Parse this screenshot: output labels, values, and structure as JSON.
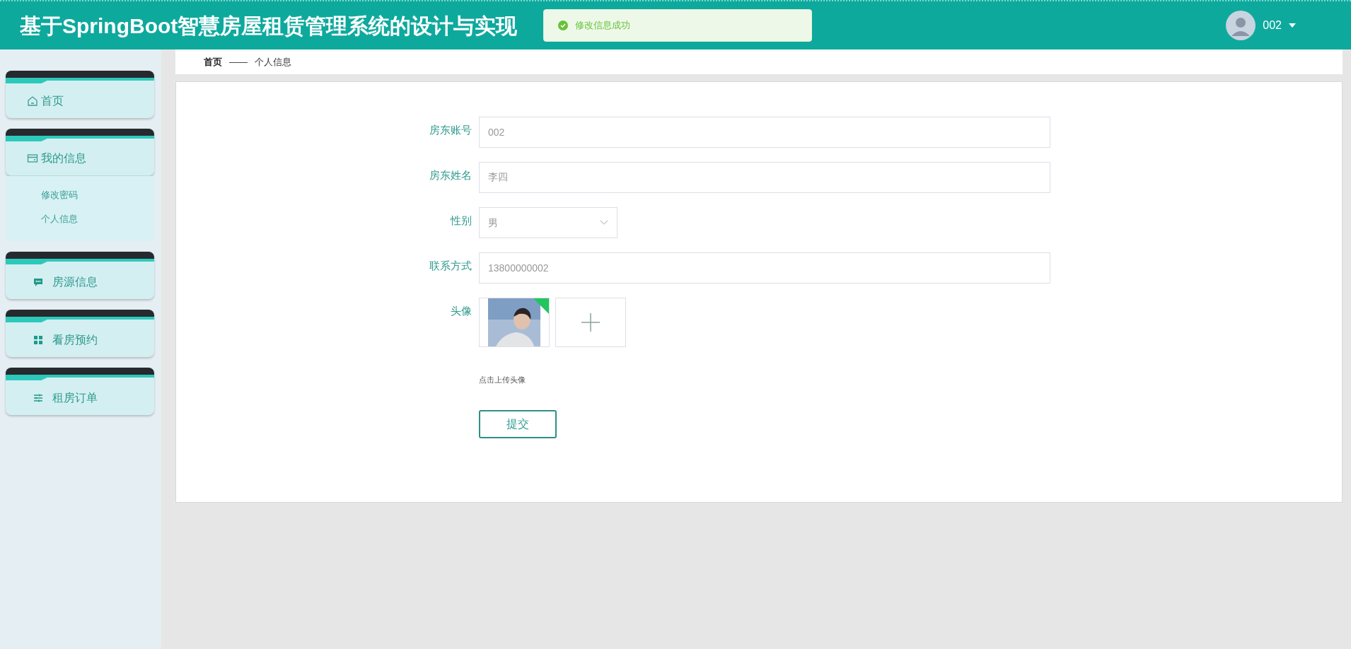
{
  "header": {
    "title": "基于SpringBoot智慧房屋租赁管理系统的设计与实现",
    "toast": "修改信息成功",
    "user": "002"
  },
  "sidebar": {
    "items": [
      {
        "label": "首页",
        "expanded": false
      },
      {
        "label": "我的信息",
        "expanded": true,
        "children": [
          {
            "label": "修改密码"
          },
          {
            "label": "个人信息"
          }
        ]
      },
      {
        "label": "房源信息",
        "expanded": false
      },
      {
        "label": "看房预约",
        "expanded": false
      },
      {
        "label": "租房订单",
        "expanded": false
      }
    ]
  },
  "breadcrumb": [
    "首页",
    "——",
    "个人信息"
  ],
  "form": {
    "fields": [
      {
        "kind": "text",
        "label": "房东账号",
        "value": "002"
      },
      {
        "kind": "text",
        "label": "房东姓名",
        "value": "李四"
      },
      {
        "kind": "select",
        "label": "性别",
        "value": "男"
      },
      {
        "kind": "text",
        "label": "联系方式",
        "value": "13800000002"
      },
      {
        "kind": "upload",
        "label": "头像",
        "hint": "点击上传头像"
      }
    ],
    "submit": "提交"
  }
}
